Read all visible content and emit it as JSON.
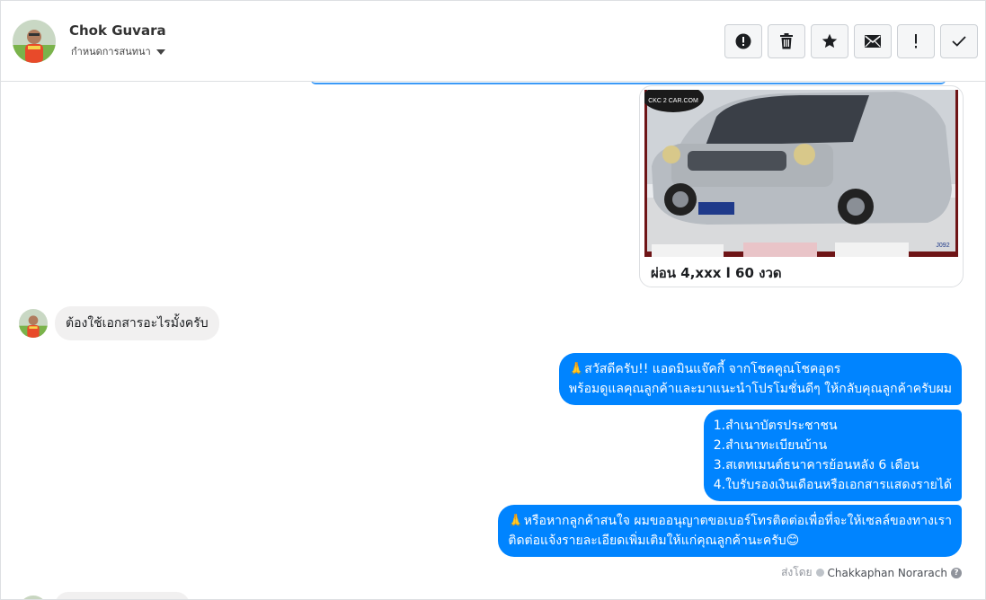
{
  "header": {
    "contact_name": "Chok Guvara",
    "assign_label": "กำหนดการสนทนา",
    "actions": [
      {
        "name": "spam-button",
        "icon": "alert-circle-icon"
      },
      {
        "name": "delete-button",
        "icon": "trash-icon"
      },
      {
        "name": "star-button",
        "icon": "star-icon"
      },
      {
        "name": "mark-unread-button",
        "icon": "envelope-icon"
      },
      {
        "name": "follow-up-button",
        "icon": "exclamation-icon"
      },
      {
        "name": "mark-done-button",
        "icon": "check-icon"
      }
    ]
  },
  "messages": {
    "image_caption": "ผ่อน 4,xxx l 60 งวด",
    "image_watermark": "CKC 2 CAR.COM",
    "image_code": "J092",
    "incoming_1": "ต้องใช้เอกสารอะไรมั้งครับ",
    "outgoing_1": "🙏สวัสดีครับ!! แอดมินแจ๊คกี้ จากโชคคูณโชคอุดร\nพร้อมดูแลคุณลูกค้าและมาแนะนำโปรโมชั่นดีๆ ให้กลับคุณลูกค้าครับผม",
    "outgoing_2": "1.สำเนาบัตรประชาชน\n2.สำเนาทะเบียนบ้าน\n3.สเตทเมนต์ธนาคารย้อนหลัง 6 เดือน\n4.ใบรับรองเงินเดือนหรือเอกสารแสดงรายได้",
    "outgoing_3": "🙏หรือหากลูกค้าสนใจ ผมขออนุญาตขอเบอร์โทรติดต่อเพื่อที่จะให้เซลล์ของทางเรา\nติดต่อแจ้งรายละเอียดเพิ่มเติมให้แก่คุณลูกค้านะครับ😊",
    "sent_by_label": "ส่งโดย",
    "sent_by_name": "Chakkaphan Norarach"
  },
  "colors": {
    "outgoing_bubble": "#0084ff",
    "incoming_bubble": "#f1f0f0",
    "accent_line": "#3b9af7"
  }
}
